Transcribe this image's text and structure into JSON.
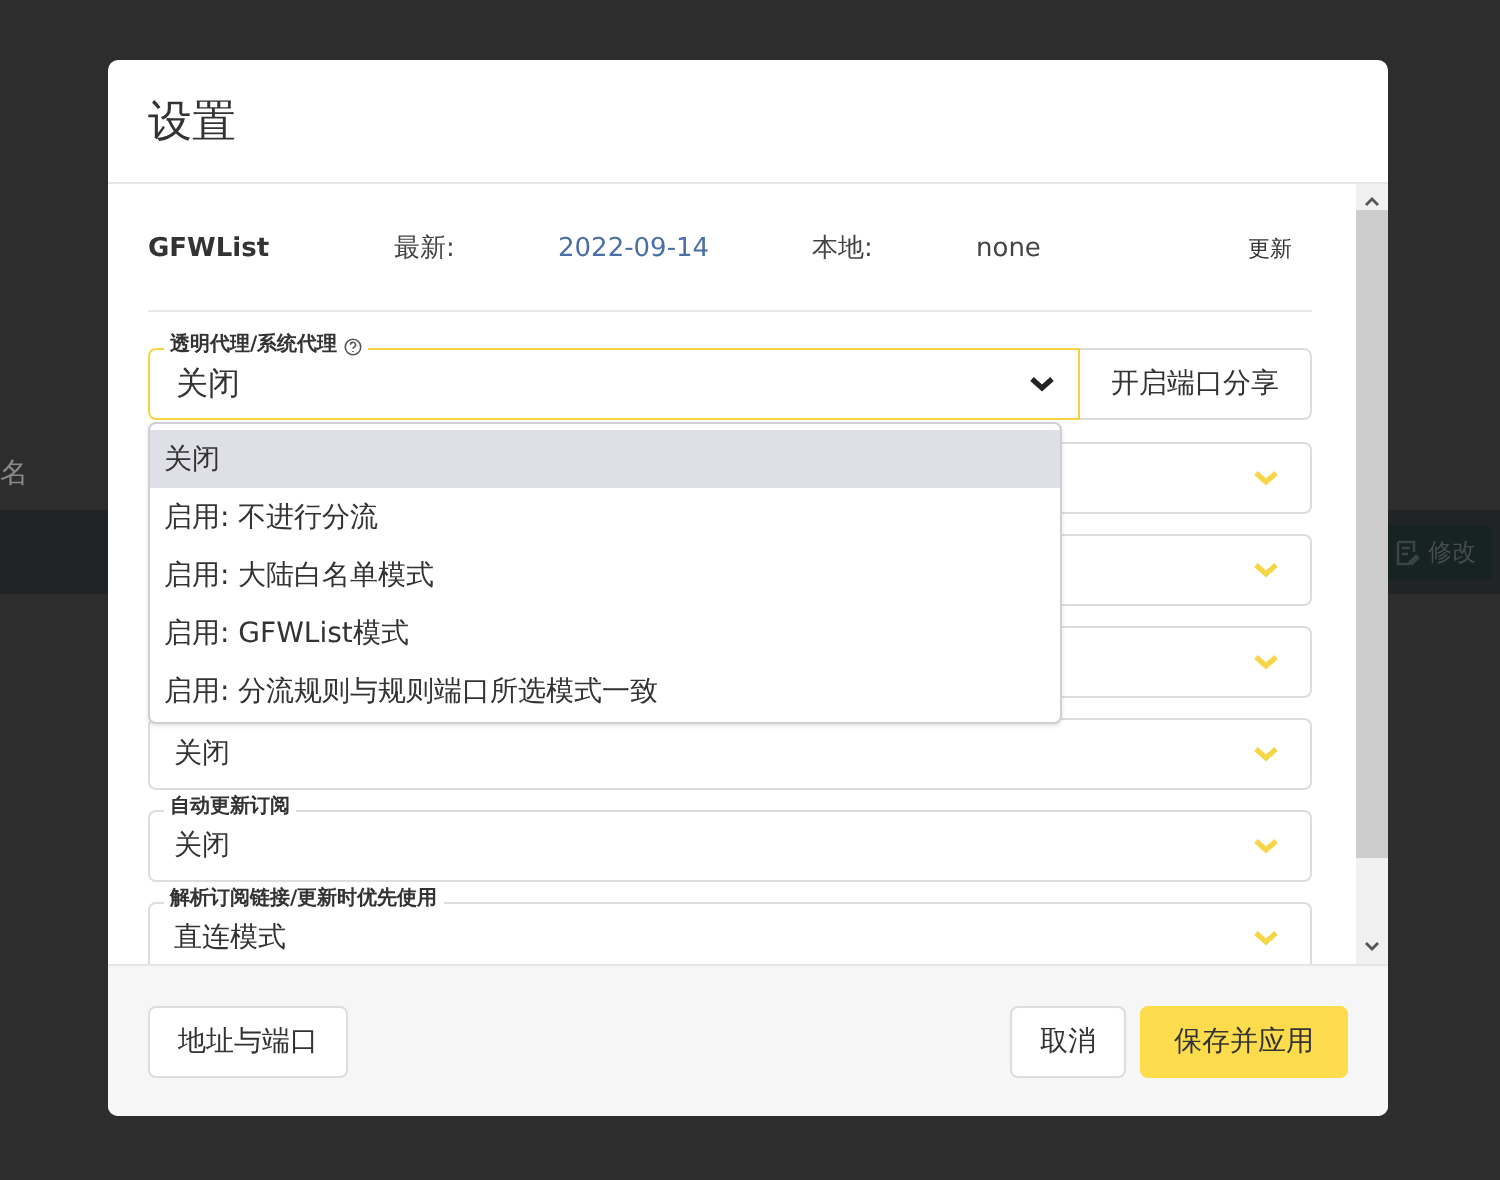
{
  "window": {
    "title": "设置"
  },
  "background": {
    "text": "名",
    "edit_button": "修改"
  },
  "gfwlist": {
    "name": "GFWList",
    "latest_label": "最新:",
    "latest": "2022-09-14",
    "local_label": "本地:",
    "local": "none",
    "update_button": "更新"
  },
  "proxy": {
    "label": "透明代理/系统代理",
    "value": "关闭",
    "expanded": true,
    "port_share_button": "开启端口分享",
    "options": [
      {
        "label": "关闭",
        "selected": true
      },
      {
        "label": "启用: 不进行分流",
        "selected": false
      },
      {
        "label": "启用: 大陆白名单模式",
        "selected": false
      },
      {
        "label": "启用: GFWList模式",
        "selected": false
      },
      {
        "label": "启用: 分流规则与规则端口所选模式一致",
        "selected": false
      }
    ]
  },
  "fields": [
    {
      "kind": "select"
    },
    {
      "kind": "select"
    },
    {
      "kind": "select"
    },
    {
      "kind": "select",
      "value": "关闭"
    },
    {
      "kind": "select",
      "label": "自动更新订阅",
      "value": "关闭"
    },
    {
      "kind": "select",
      "label": "解析订阅链接/更新时优先使用",
      "value": "直连模式"
    }
  ],
  "footer": {
    "address_button": "地址与端口",
    "cancel_button": "取消",
    "save_button": "保存并应用"
  }
}
